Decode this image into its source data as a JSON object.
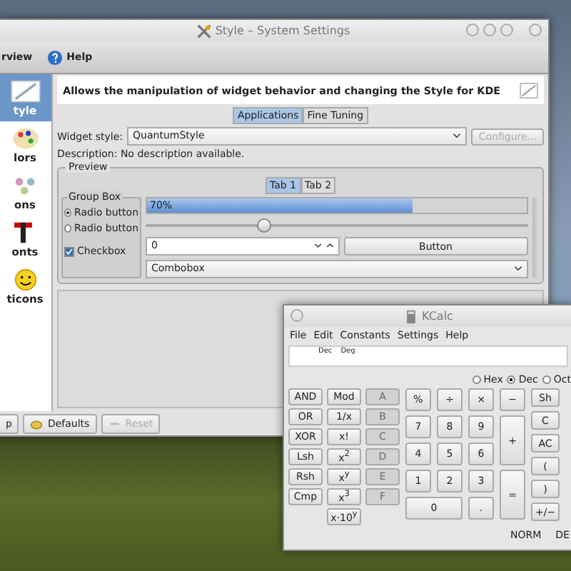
{
  "main_window": {
    "title": "Style – System Settings",
    "toolbar": [
      {
        "label": "rview"
      },
      {
        "label": "Help"
      }
    ],
    "sidebar": [
      {
        "label": "tyle",
        "selected": true
      },
      {
        "label": "lors",
        "selected": false
      },
      {
        "label": "ons",
        "selected": false
      },
      {
        "label": "onts",
        "selected": false
      },
      {
        "label": "ticons",
        "selected": false
      }
    ],
    "header": "Allows the manipulation of widget behavior and changing the Style for KDE",
    "tabs": [
      {
        "label": "Applications",
        "selected": true
      },
      {
        "label": "Fine Tuning",
        "selected": false
      }
    ],
    "widget_style": {
      "label": "Widget style:",
      "value": "QuantumStyle"
    },
    "configure_button": {
      "label": "Configure...",
      "disabled": true
    },
    "description": "Description: No description available.",
    "preview": {
      "title": "Preview",
      "tabs": [
        {
          "label": "Tab 1",
          "selected": true
        },
        {
          "label": "Tab 2",
          "selected": false
        }
      ],
      "group_box": {
        "title": "Group Box",
        "radios": [
          {
            "label": "Radio button",
            "selected": true
          },
          {
            "label": "Radio button",
            "selected": false
          }
        ],
        "checkbox": {
          "label": "Checkbox",
          "checked": true
        }
      },
      "progress": {
        "label": "70%",
        "level": 0.7
      },
      "slider": {
        "level": 0.31
      },
      "spinbox": {
        "value": "0"
      },
      "button": "Button",
      "combobox": "Combobox"
    },
    "buttons": [
      {
        "label": "p",
        "disabled": false
      },
      {
        "label": "Defaults",
        "disabled": false
      },
      {
        "label": "Reset",
        "disabled": true
      }
    ]
  },
  "kcalc": {
    "title": "KCalc",
    "menu": [
      "File",
      "Edit",
      "Constants",
      "Settings",
      "Help"
    ],
    "display": [
      "Dec",
      "Deg"
    ],
    "bases": [
      {
        "label": "Hex",
        "selected": false
      },
      {
        "label": "Dec",
        "selected": true
      },
      {
        "label": "Oct",
        "selected": false
      }
    ],
    "function_keys": [
      {
        "label": "AND",
        "disabled": false
      },
      {
        "label": "Mod",
        "disabled": false
      },
      {
        "label": "A",
        "disabled": true
      },
      {
        "label": "OR",
        "disabled": false
      },
      {
        "label": "1/x",
        "disabled": false
      },
      {
        "label": "B",
        "disabled": true
      },
      {
        "label": "XOR",
        "disabled": false
      },
      {
        "label": "x!",
        "disabled": false
      },
      {
        "label": "C",
        "disabled": true
      },
      {
        "label": "Lsh",
        "disabled": false
      },
      {
        "label": "x$^{2}$",
        "disabled": false
      },
      {
        "label": "D",
        "disabled": true
      },
      {
        "label": "Rsh",
        "disabled": false
      },
      {
        "label": "x$^{y}$",
        "disabled": false
      },
      {
        "label": "E",
        "disabled": true
      },
      {
        "label": "Cmp",
        "disabled": false
      },
      {
        "label": "x$^{3}$",
        "disabled": false
      },
      {
        "label": "F",
        "disabled": true
      }
    ],
    "exp_key": "x·10$^{y}$",
    "pad_keys": [
      {
        "label": "%",
        "kind": "normal"
      },
      {
        "label": "÷",
        "kind": "normal"
      },
      {
        "label": "×",
        "kind": "normal"
      },
      {
        "label": "−",
        "kind": "normal"
      },
      {
        "label": "7",
        "kind": "normal"
      },
      {
        "label": "8",
        "kind": "normal"
      },
      {
        "label": "9",
        "kind": "normal"
      },
      {
        "label": "+",
        "kind": "tall"
      },
      {
        "label": "4",
        "kind": "normal"
      },
      {
        "label": "5",
        "kind": "normal"
      },
      {
        "label": "6",
        "kind": "normal"
      },
      {
        "label": "1",
        "kind": "normal"
      },
      {
        "label": "2",
        "kind": "normal"
      },
      {
        "label": "3",
        "kind": "normal"
      },
      {
        "label": "=",
        "kind": "tall"
      },
      {
        "label": "0",
        "kind": "wide"
      },
      {
        "label": ".",
        "kind": "normal"
      }
    ],
    "side_keys": [
      "Sh",
      "C",
      "AC",
      "(",
      ")",
      "+/−"
    ],
    "status": [
      "NORM",
      "DE"
    ]
  }
}
